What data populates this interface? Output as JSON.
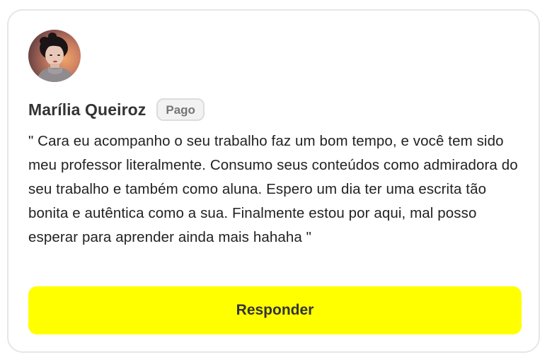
{
  "comment_card": {
    "author_name": "Marília Queiroz",
    "badge_label": "Pago",
    "comment_text": "\" Cara eu acompanho o seu trabalho faz um bom tempo, e você tem sido meu professor literalmente. Consumo seus conteúdos como admiradora do seu trabalho e também como aluna. Espero um dia ter uma escrita tão bonita e autêntica como a sua. Finalmente estou por aqui, mal posso esperar para aprender ainda mais hahaha \"",
    "reply_button_label": "Responder"
  },
  "colors": {
    "reply_button_bg": "#ffff00",
    "badge_bg": "#f2f2f2",
    "badge_text": "#757575",
    "card_border": "#e6e6e6"
  }
}
